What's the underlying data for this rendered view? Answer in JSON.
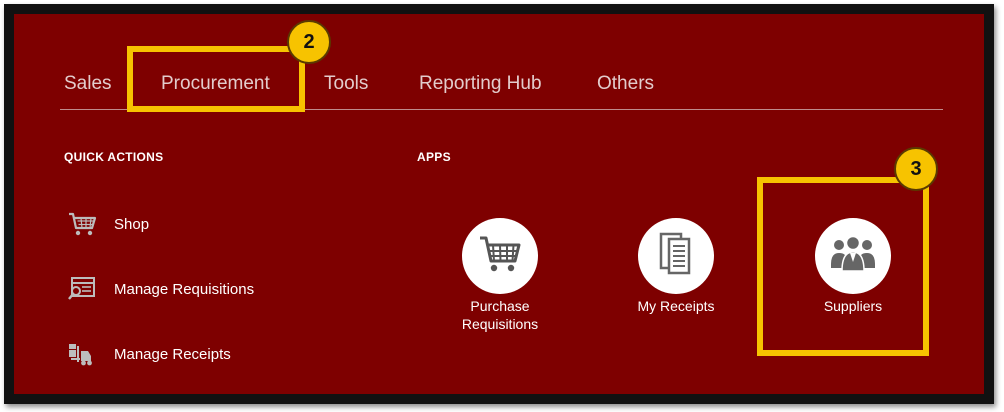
{
  "tabs": [
    {
      "label": "Sales"
    },
    {
      "label": "Procurement"
    },
    {
      "label": "Tools"
    },
    {
      "label": "Reporting Hub"
    },
    {
      "label": "Others"
    }
  ],
  "quick_actions": {
    "heading": "QUICK ACTIONS",
    "items": [
      {
        "label": "Shop",
        "icon": "cart-icon"
      },
      {
        "label": "Manage Requisitions",
        "icon": "requisition-form-icon"
      },
      {
        "label": "Manage Receipts",
        "icon": "forklift-icon"
      }
    ]
  },
  "apps": {
    "heading": "APPS",
    "items": [
      {
        "line1": "Purchase",
        "line2": "Requisitions",
        "icon": "shopping-cart-icon"
      },
      {
        "line1": "My Receipts",
        "line2": "",
        "icon": "documents-icon"
      },
      {
        "line1": "Suppliers",
        "line2": "",
        "icon": "people-group-icon"
      }
    ]
  },
  "callouts": {
    "procurement_step": "2",
    "suppliers_step": "3"
  },
  "colors": {
    "panel_bg": "#7e0000",
    "highlight": "#f7c300",
    "icon_gray": "#666666"
  }
}
